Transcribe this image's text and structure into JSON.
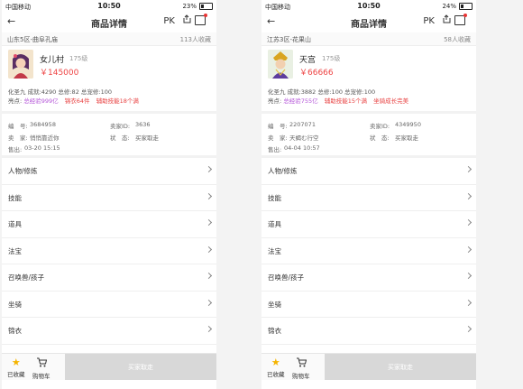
{
  "status": {
    "carrier": "中国移动",
    "time": "10:50",
    "battery_left": "23%",
    "battery_right": "24%"
  },
  "nav": {
    "title": "商品详情",
    "pk": "PK"
  },
  "menu_items": [
    "人物/修炼",
    "技能",
    "道具",
    "法宝",
    "召唤兽/孩子",
    "坐骑",
    "锦衣"
  ],
  "bottom": {
    "fav_label": "已收藏",
    "cart_label": "购物车",
    "buy_label": "买家取走"
  },
  "left": {
    "server": "山东5区-曲阜孔庙",
    "fav_count": "113人收藏",
    "name": "女儿村",
    "level": "175级",
    "price": "￥145000",
    "attrs": "化圣九 成就:4290 总修:82 总宠修:100",
    "tags_label": "亮点:",
    "tags": [
      "总经验999亿",
      "锦衣64件",
      "辅助技能18个满"
    ],
    "info": {
      "id_label": "编　号:",
      "id": "3684958",
      "seller_id_label": "卖家ID:",
      "seller_id": "3636",
      "seller_label": "卖　家:",
      "seller": "悄悄靠近你",
      "state_label": "状　态:",
      "state": "买家取走",
      "sold_label": "售出:",
      "sold": "03-20 15:15"
    }
  },
  "right": {
    "server": "江苏3区-花果山",
    "fav_count": "58人收藏",
    "name": "天宫",
    "level": "175级",
    "price": "￥66666",
    "attrs": "化圣九 成就:3882 总修:100 总宠修:100",
    "tags_label": "亮点:",
    "tags": [
      "总经验755亿",
      "辅助技能15个满",
      "坐骑成长完美"
    ],
    "info": {
      "id_label": "编　号:",
      "id": "2207071",
      "seller_id_label": "卖家ID:",
      "seller_id": "4349950",
      "seller_label": "卖　家:",
      "seller": "天蝎む行空",
      "state_label": "状　态:",
      "state": "买家取走",
      "sold_label": "售出:",
      "sold": "04-04 10:57"
    }
  },
  "colors": {
    "price": "#ee4444",
    "tag_purple": "#b455d8",
    "tag_red": "#e84040",
    "star": "#f5b400"
  },
  "icons": [
    "back-arrow-icon",
    "share-icon",
    "message-icon",
    "chevron-right-icon",
    "star-icon",
    "cart-icon"
  ]
}
